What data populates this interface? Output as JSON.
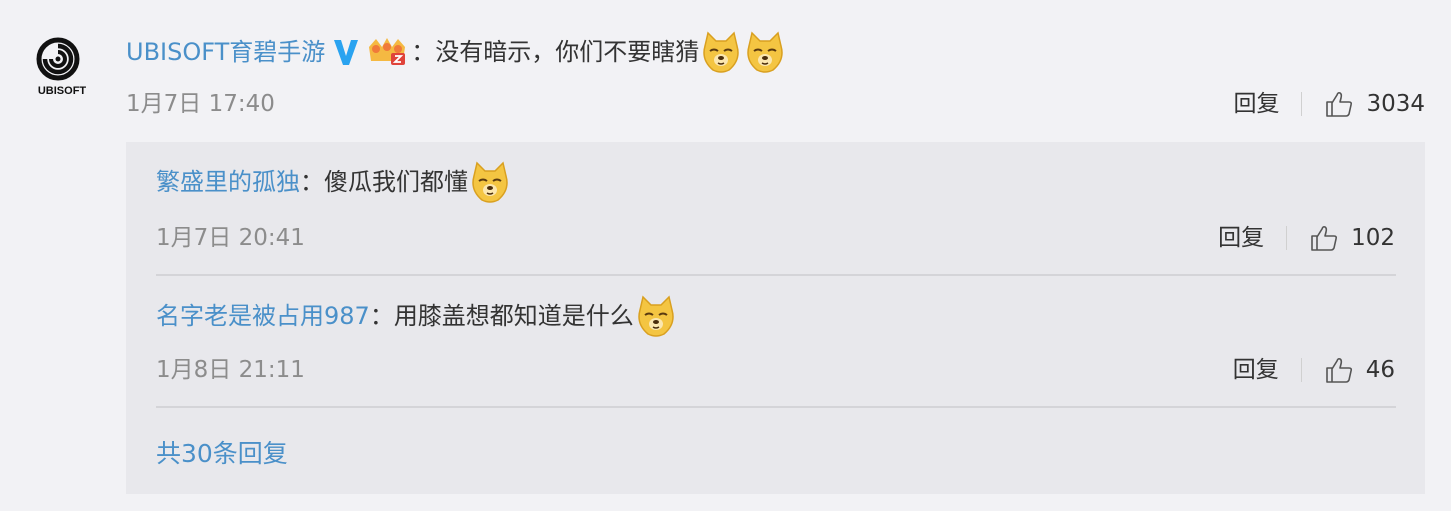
{
  "comment": {
    "avatar_text": "UBISOFT",
    "author": "UBISOFT育碧手游",
    "separator": "：",
    "text": "没有暗示，你们不要瞎猜",
    "emojis": [
      "doge-emoji",
      "doge-emoji"
    ],
    "time": "1月7日 17:40",
    "reply_label": "回复",
    "likes": "3034"
  },
  "replies": [
    {
      "author": "繁盛里的孤独",
      "separator": "：",
      "text": "傻瓜我们都懂",
      "time": "1月7日 20:41",
      "reply_label": "回复",
      "likes": "102"
    },
    {
      "author": "名字老是被占用987",
      "separator": "：",
      "text": "用膝盖想都知道是什么",
      "time": "1月8日 21:11",
      "reply_label": "回复",
      "likes": "46"
    }
  ],
  "more_replies": "共30条回复",
  "colors": {
    "link": "#4a90c9",
    "verified_badge": "#2aa3f0",
    "background": "#f2f2f5",
    "reply_box": "#e8e8ec"
  }
}
